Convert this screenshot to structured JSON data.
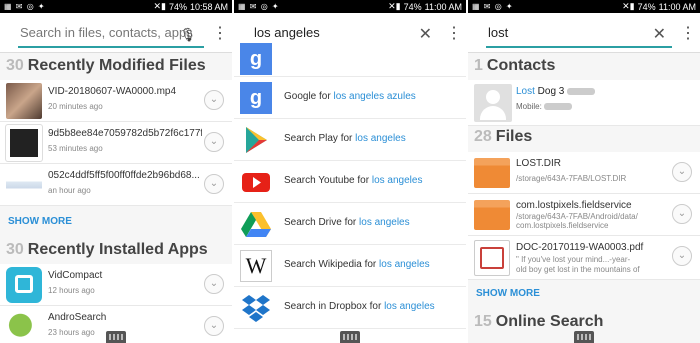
{
  "status": {
    "battery": "74%",
    "times": [
      "10:58 AM",
      "11:00 AM",
      "11:00 AM"
    ]
  },
  "panel1": {
    "search_placeholder": "Search in files, contacts, apps",
    "recent_files": {
      "count": "30",
      "title": "Recently Modified Files",
      "items": [
        {
          "name": "VID-20180607-WA0000.mp4",
          "time": "20 minutes ago"
        },
        {
          "name": "9d5b8ee84e7059782d5b72f6c177f0f...",
          "time": "53 minutes ago"
        },
        {
          "name": "052c4ddf5ff5f00ff0ffde2b96bd68...",
          "time": "an hour ago"
        }
      ],
      "show_more": "SHOW MORE"
    },
    "recent_apps": {
      "count": "30",
      "title": "Recently Installed Apps",
      "items": [
        {
          "name": "VidCompact",
          "time": "12 hours ago"
        },
        {
          "name": "AndroSearch",
          "time": "23 hours ago"
        }
      ]
    }
  },
  "panel2": {
    "search_value": "los angeles",
    "query": "los angeles",
    "items": [
      {
        "prefix": "Google for ",
        "query": "los angeles azules",
        "icon": "google-icon"
      },
      {
        "prefix": "Search Play for ",
        "query": "los angeles",
        "icon": "play-store-icon"
      },
      {
        "prefix": "Search Youtube for ",
        "query": "los angeles",
        "icon": "youtube-icon"
      },
      {
        "prefix": "Search Drive for ",
        "query": "los angeles",
        "icon": "drive-icon"
      },
      {
        "prefix": "Search Wikipedia for ",
        "query": "los angeles",
        "icon": "wikipedia-icon"
      },
      {
        "prefix": "Search in Dropbox for ",
        "query": "los angeles",
        "icon": "dropbox-icon"
      }
    ]
  },
  "panel3": {
    "search_value": "lost",
    "contacts": {
      "count": "1",
      "title": "Contacts",
      "items": [
        {
          "name_hit": "Lost",
          "name_rest": " Dog 3",
          "mobile_label": "Mobile:"
        }
      ]
    },
    "files": {
      "count": "28",
      "title": "Files",
      "items": [
        {
          "name": "LOST.DIR",
          "path": "/storage/643A-7FAB/LOST.DIR"
        },
        {
          "name": "com.lostpixels.fieldservice",
          "path": "/storage/643A-7FAB/Android/data/ com.lostpixels.fieldservice"
        },
        {
          "name": "DOC-20170119-WA0003.pdf",
          "snippet1": "\" If you've lost your mind...-year-",
          "snippet2": "old boy get lost in the mountains of"
        }
      ],
      "show_more": "SHOW MORE"
    },
    "online": {
      "count": "15",
      "title": "Online Search"
    }
  }
}
